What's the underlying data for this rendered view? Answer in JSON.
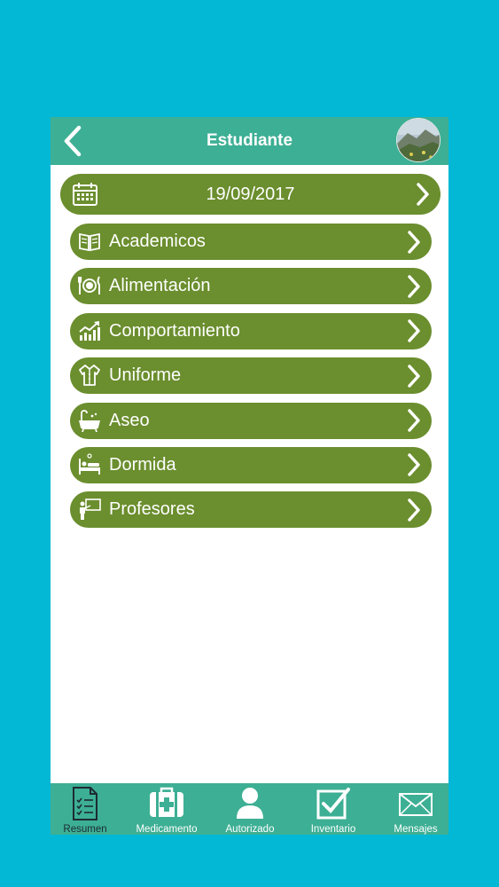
{
  "header": {
    "title": "Estudiante"
  },
  "date_row": {
    "date": "19/09/2017"
  },
  "menu": {
    "items": [
      {
        "label": "Academicos",
        "icon": "book-icon"
      },
      {
        "label": "Alimentación",
        "icon": "plate-cutlery-icon"
      },
      {
        "label": "Comportamiento",
        "icon": "chart-trend-icon"
      },
      {
        "label": "Uniforme",
        "icon": "uniform-icon"
      },
      {
        "label": "Aseo",
        "icon": "bathtub-icon"
      },
      {
        "label": "Dormida",
        "icon": "bed-icon"
      },
      {
        "label": "Profesores",
        "icon": "teacher-board-icon"
      }
    ]
  },
  "tabbar": {
    "tabs": [
      {
        "label": "Resumen",
        "icon": "document-list-icon",
        "active": true
      },
      {
        "label": "Medicamento",
        "icon": "first-aid-kit-icon",
        "active": false
      },
      {
        "label": "Autorizado",
        "icon": "person-icon",
        "active": false
      },
      {
        "label": "Inventario",
        "icon": "checkbox-icon",
        "active": false
      },
      {
        "label": "Mensajes",
        "icon": "envelope-icon",
        "active": false
      }
    ]
  },
  "colors": {
    "background": "#03b8d4",
    "header": "#3daf94",
    "row": "#6b8e2e",
    "active_tab_label": "#1d2b33"
  }
}
